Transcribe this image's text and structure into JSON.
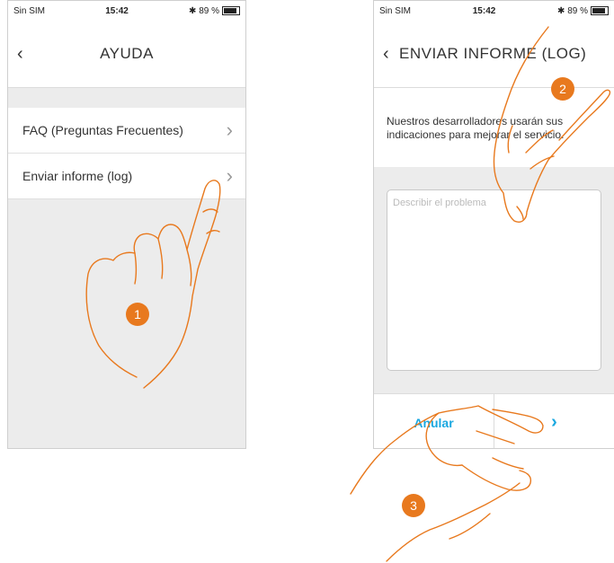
{
  "phone1": {
    "status": {
      "carrier": "Sin SIM",
      "time": "15:42",
      "battery": "✱ 89 %"
    },
    "nav": {
      "back": "‹",
      "title": "AYUDA"
    },
    "items": [
      {
        "label": "FAQ (Preguntas Frecuentes)",
        "chevron": "›"
      },
      {
        "label": "Enviar informe (log)",
        "chevron": "›"
      }
    ],
    "step": "1"
  },
  "phone2": {
    "status": {
      "carrier": "Sin SIM",
      "time": "15:42",
      "battery": "✱ 89 %"
    },
    "nav": {
      "back": "‹",
      "title": "ENVIAR INFORME (LOG)"
    },
    "description": "Nuestros desarrolladores usarán sus indicaciones para mejorar el servicio.",
    "textarea_placeholder": "Describir el problema",
    "buttons": {
      "cancel": "Anular",
      "next": "›"
    },
    "steps": [
      "2",
      "3"
    ]
  },
  "colors": {
    "accent": "#e8791e",
    "link": "#1aa8e0",
    "background": "#ececec"
  }
}
